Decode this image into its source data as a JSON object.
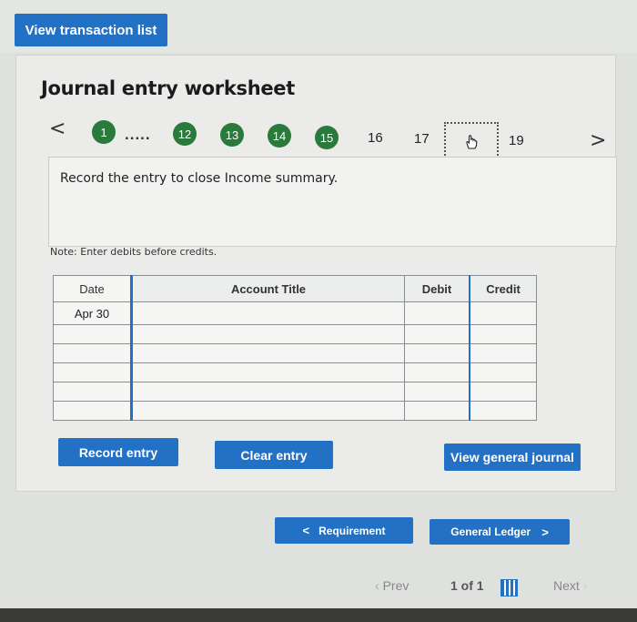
{
  "header": {
    "view_transaction_list": "View transaction list"
  },
  "worksheet": {
    "title": "Journal entry worksheet",
    "nav": {
      "prev_arrow": "<",
      "next_arrow": ">",
      "dots": ".....",
      "steps_done": [
        "1",
        "12",
        "13",
        "14",
        "15"
      ],
      "steps_pending": [
        "16",
        "17",
        "19"
      ],
      "current_step_icon": "hand-pointer-icon"
    },
    "prompt": "Record the entry to close Income summary.",
    "note": "Note: Enter debits before credits.",
    "table": {
      "headers": [
        "Date",
        "Account Title",
        "Debit",
        "Credit"
      ],
      "date_value": "Apr 30",
      "row_count": 6
    },
    "buttons": {
      "record_entry": "Record entry",
      "clear_entry": "Clear entry",
      "view_general_journal": "View general journal"
    }
  },
  "bottom_nav": {
    "requirement_label": "Requirement",
    "requirement_arrow": "<",
    "general_ledger_label": "General Ledger",
    "general_ledger_arrow": ">",
    "prev": "Prev",
    "page": "1 of 1",
    "next": "Next"
  },
  "colors": {
    "accent": "#2371c4",
    "done_step": "#2a7a3b"
  }
}
